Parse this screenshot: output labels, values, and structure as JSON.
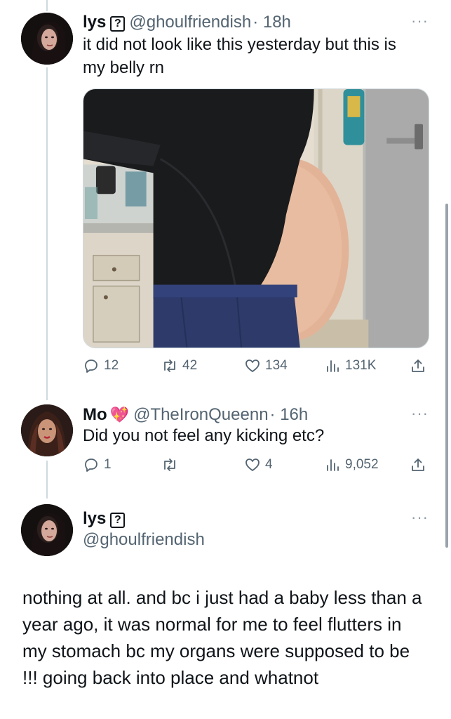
{
  "tweet1": {
    "name": "lys",
    "name_badge": "?",
    "handle": "@ghoulfriendish",
    "time": "· 18h",
    "text_line1": "it did not look like this yesterday but this is",
    "text_line2": "my belly rn",
    "more": "···",
    "stats": {
      "replies": "12",
      "retweets": "42",
      "likes": "134",
      "views": "131K"
    }
  },
  "tweet2": {
    "name": "Mo",
    "handle": "@TheIronQueenn",
    "time": "· 16h",
    "text": "Did you not feel any kicking etc?",
    "more": "···",
    "stats": {
      "replies": "1",
      "retweets": "",
      "likes": "4",
      "views": "9,052"
    }
  },
  "tweet3": {
    "name": "lys",
    "name_badge": "?",
    "handle": "@ghoulfriendish",
    "more": "···",
    "text": "nothing at all. and bc i just had a baby less than a year ago, it was normal for me to feel flutters in my stomach bc my organs were supposed to be !!! going back into place and whatnot"
  },
  "icons": [
    "reply-icon",
    "retweet-icon",
    "like-icon",
    "views-icon",
    "share-icon",
    "more-icon",
    "sparkle-heart-icon"
  ],
  "colors": {
    "text": "#0f1419",
    "secondary": "#536471",
    "thread_line": "#cfd9de",
    "emoji_heart": "#e0309c"
  }
}
